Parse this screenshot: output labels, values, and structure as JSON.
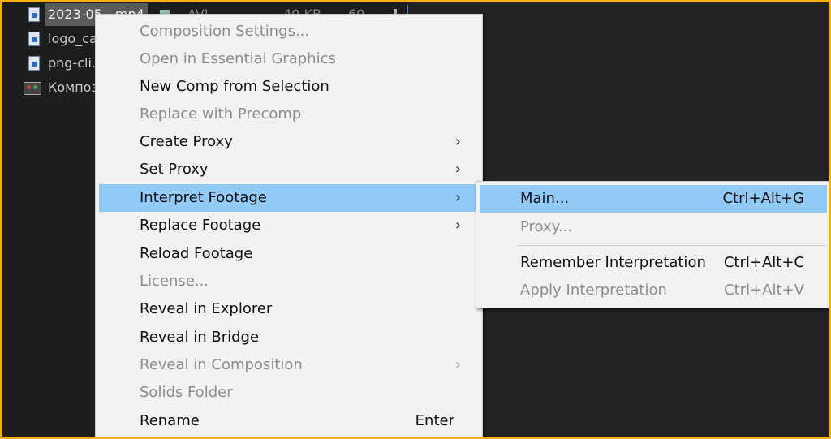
{
  "project_panel": {
    "rows": [
      {
        "name": "2023-05…mp4",
        "type": "AVI",
        "size": "40 KB",
        "duration": "60"
      },
      {
        "name": "logo_ca"
      },
      {
        "name": "png-cli…"
      },
      {
        "name": "Композ"
      }
    ]
  },
  "context_menu": {
    "items": [
      {
        "label": "Composition Settings..."
      },
      {
        "label": "Open in Essential Graphics"
      },
      {
        "label": "New Comp from Selection"
      },
      {
        "label": "Replace with Precomp"
      },
      {
        "label": "Create Proxy",
        "arrow": "›"
      },
      {
        "label": "Set Proxy",
        "arrow": "›"
      },
      {
        "label": "Interpret Footage",
        "arrow": "›"
      },
      {
        "label": "Replace Footage",
        "arrow": "›"
      },
      {
        "label": "Reload Footage"
      },
      {
        "label": "License..."
      },
      {
        "label": "Reveal in Explorer"
      },
      {
        "label": "Reveal in Bridge"
      },
      {
        "label": "Reveal in Composition",
        "arrow": "›"
      },
      {
        "label": "Solids Folder"
      },
      {
        "label": "Rename",
        "shortcut": "Enter"
      }
    ]
  },
  "submenu": {
    "items": [
      {
        "label": "Main...",
        "shortcut": "Ctrl+Alt+G"
      },
      {
        "label": "Proxy..."
      },
      {
        "label": "Remember Interpretation",
        "shortcut": "Ctrl+Alt+C"
      },
      {
        "label": "Apply Interpretation",
        "shortcut": "Ctrl+Alt+V"
      }
    ]
  },
  "colors": {
    "highlight": "#91c9f7",
    "menu_bg": "#f2f2f2",
    "frame_border": "#f0b400",
    "panel_bg": "#1d1d1d"
  }
}
